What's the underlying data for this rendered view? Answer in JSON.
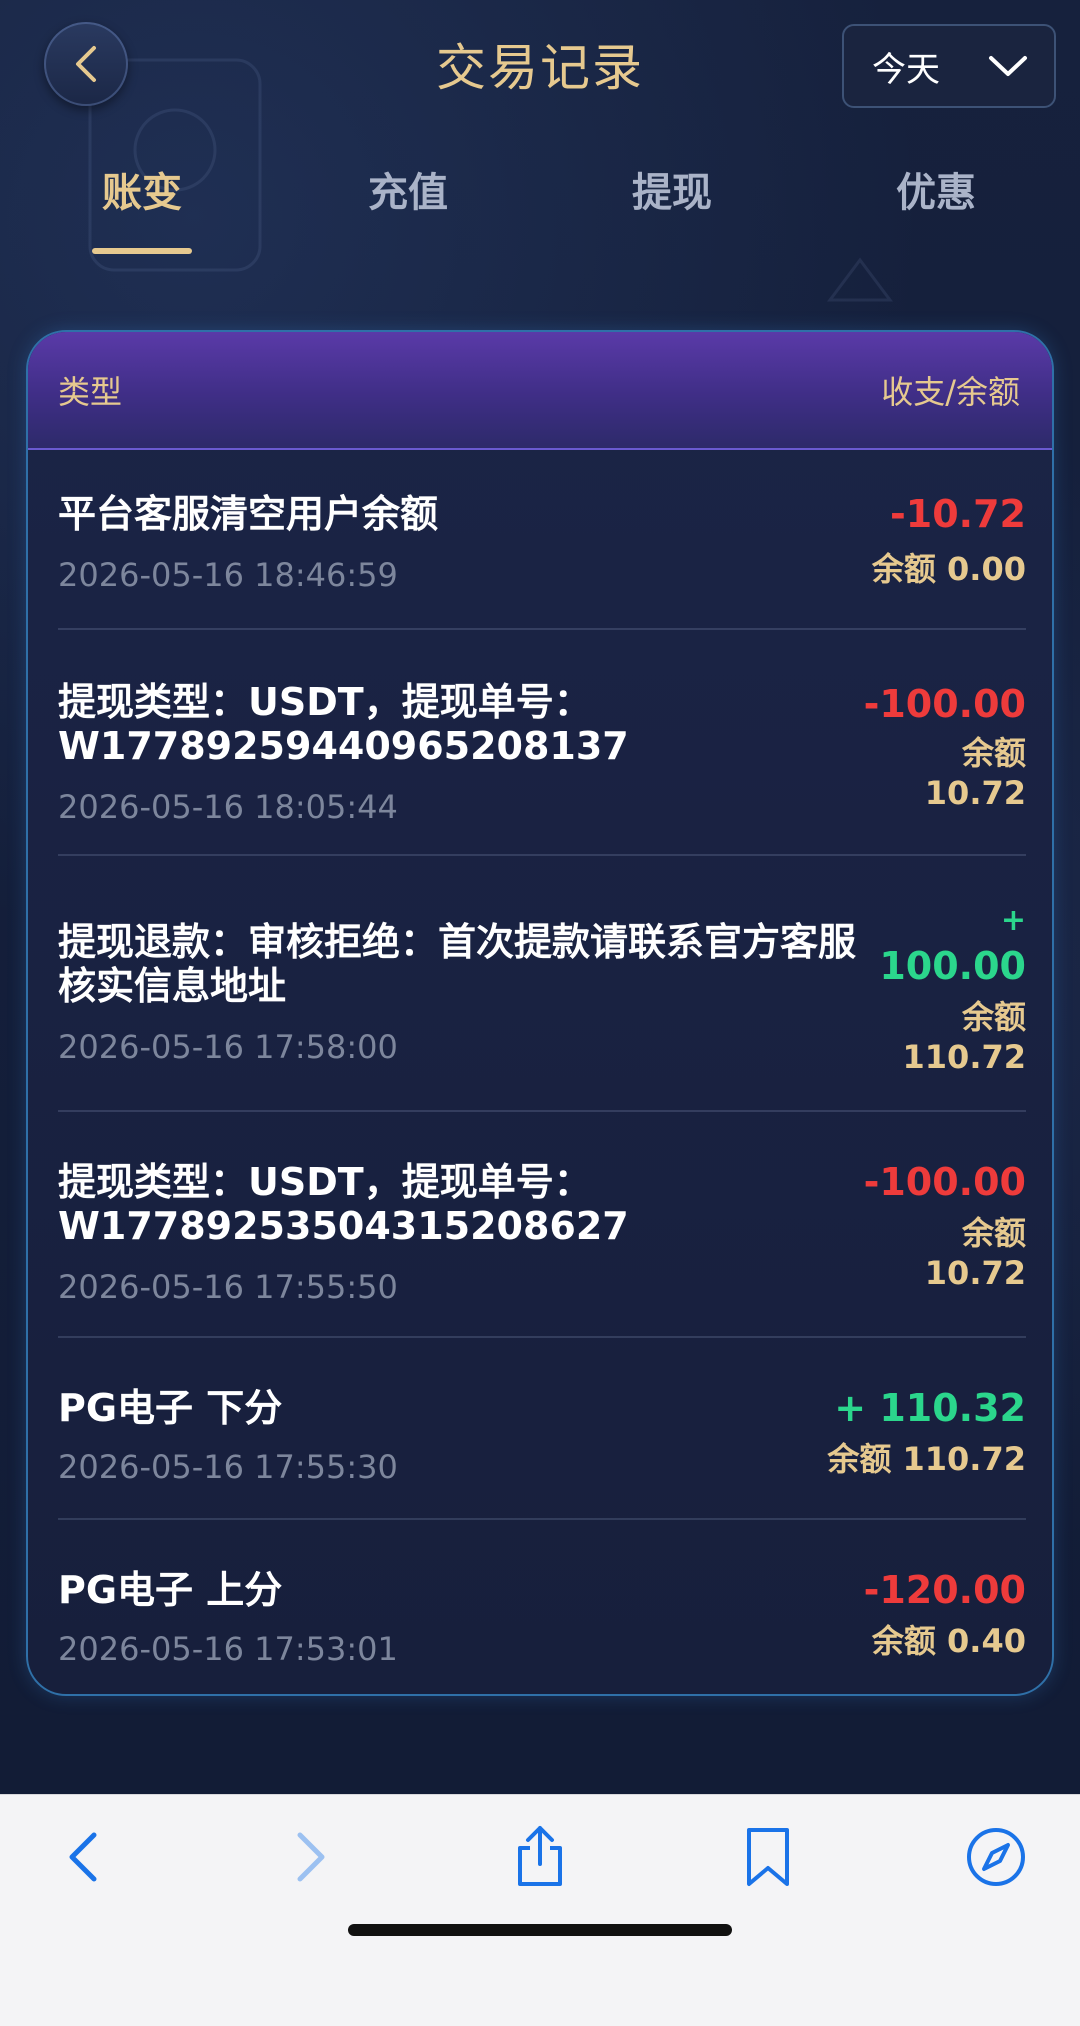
{
  "header": {
    "title": "交易记录",
    "date_filter": "今天"
  },
  "tabs": [
    {
      "label": "账变",
      "active": true
    },
    {
      "label": "充值",
      "active": false
    },
    {
      "label": "提现",
      "active": false
    },
    {
      "label": "优惠",
      "active": false
    }
  ],
  "table": {
    "col_type": "类型",
    "col_amount": "收支/余额",
    "rows": [
      {
        "title": "平台客服清空用户余额",
        "time": "2026-05-16 18:46:59",
        "amount": "-10.72",
        "balance": "余额 0.00"
      },
      {
        "title": "提现类型：USDT，提现单号：W17789259440965208137",
        "time": "2026-05-16 18:05:44",
        "amount": "-100.00",
        "balance_label": "余额",
        "balance": "10.72"
      },
      {
        "title": "提现退款：审核拒绝：首次提款请联系官方客服核实信息地址",
        "time": "2026-05-16 17:58:00",
        "amount_sign": "+",
        "amount": "100.00",
        "balance_label": "余额",
        "balance": "110.72"
      },
      {
        "title": "提现类型：USDT，提现单号：W17789253504315208627",
        "time": "2026-05-16 17:55:50",
        "amount": "-100.00",
        "balance_label": "余额",
        "balance": "10.72"
      },
      {
        "title": "PG电子 下分",
        "time": "2026-05-16 17:55:30",
        "amount": "+ 110.32",
        "balance": "余额 110.72"
      },
      {
        "title": "PG电子 上分",
        "time": "2026-05-16 17:53:01",
        "amount": "-120.00",
        "balance": "余额 0.40"
      }
    ]
  },
  "colors": {
    "gold": "#e6c98f",
    "negative": "#ee3b3b",
    "positive": "#2bd68c",
    "browser_accent": "#1a73e8"
  },
  "browser_toolbar": {
    "icons": [
      "back-icon",
      "forward-icon",
      "share-icon",
      "bookmarks-icon",
      "compass-icon"
    ]
  }
}
